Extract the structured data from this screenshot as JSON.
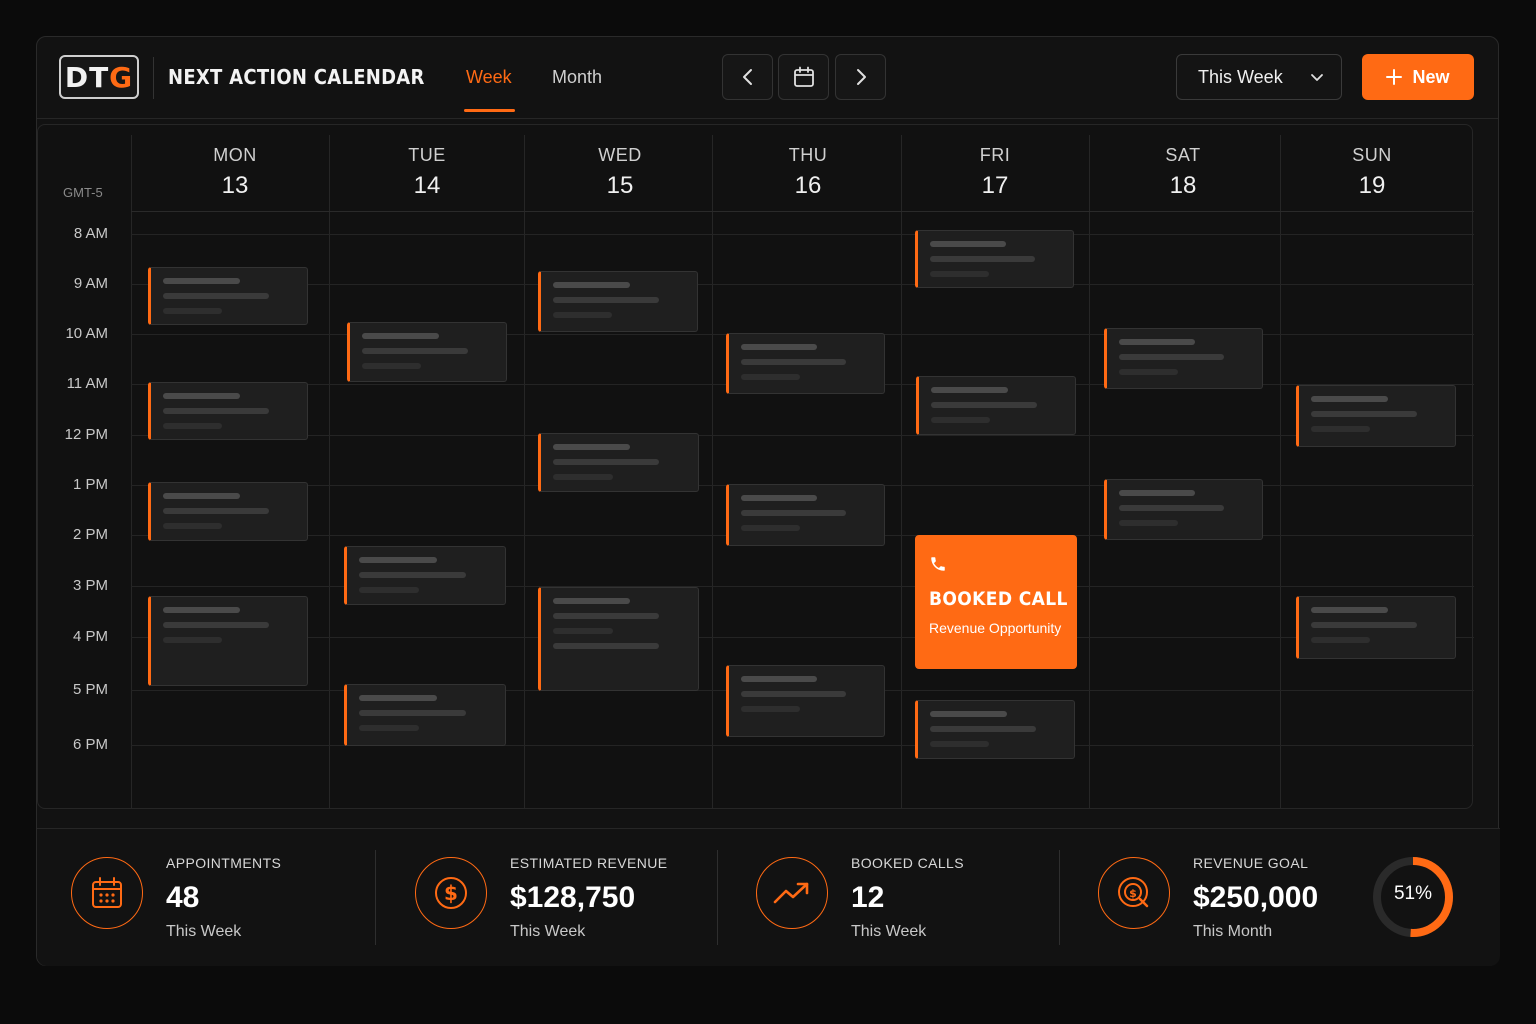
{
  "header": {
    "logo_left": "DT",
    "logo_accent": "G",
    "title": "NEXT ACTION CALENDAR",
    "tabs": [
      {
        "label": "Week",
        "active": true
      },
      {
        "label": "Month",
        "active": false
      }
    ],
    "range_label": "This Week",
    "new_label": "New"
  },
  "calendar": {
    "timezone": "GMT-5",
    "days": [
      {
        "name": "MON",
        "num": "13"
      },
      {
        "name": "TUE",
        "num": "14"
      },
      {
        "name": "WED",
        "num": "15"
      },
      {
        "name": "THU",
        "num": "16"
      },
      {
        "name": "FRI",
        "num": "17"
      },
      {
        "name": "SAT",
        "num": "18"
      },
      {
        "name": "SUN",
        "num": "19"
      }
    ],
    "hours": [
      "8 AM",
      "9 AM",
      "10 AM",
      "11 AM",
      "12 PM",
      "1 PM",
      "2 PM",
      "3 PM",
      "4 PM",
      "5 PM",
      "6 PM"
    ],
    "highlight_event": {
      "title": "BOOKED CALL",
      "subtitle": "Revenue Opportunity"
    }
  },
  "stats": [
    {
      "label": "APPOINTMENTS",
      "value": "48",
      "sub": "This Week",
      "icon": "calendar-icon"
    },
    {
      "label": "ESTIMATED REVENUE",
      "value": "$128,750",
      "sub": "This Week",
      "icon": "dollar-icon"
    },
    {
      "label": "BOOKED CALLS",
      "value": "12",
      "sub": "This Week",
      "icon": "trend-up-icon"
    },
    {
      "label": "REVENUE GOAL",
      "value": "$250,000",
      "sub": "This Month",
      "icon": "target-icon"
    }
  ],
  "goal_progress": {
    "percent": 51,
    "label": "51%"
  },
  "colors": {
    "accent": "#ff6a14",
    "background": "#121212"
  }
}
